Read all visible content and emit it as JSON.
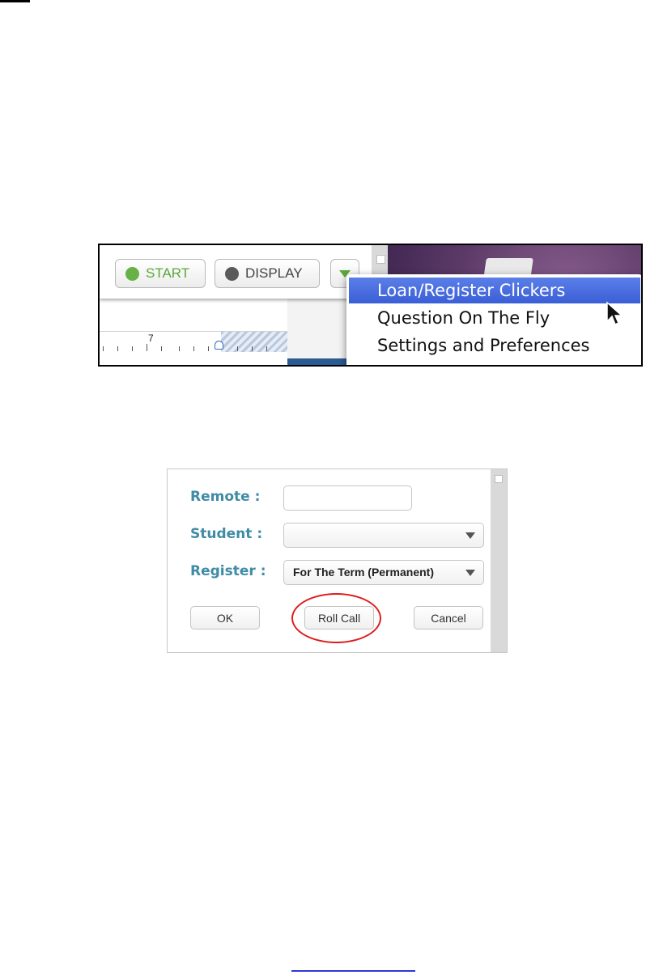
{
  "toolbar": {
    "start_label": "START",
    "display_label": "DISPLAY"
  },
  "ruler": {
    "number": "7"
  },
  "dropdown_menu": {
    "items": [
      {
        "label": "Loan/Register Clickers",
        "highlighted": true
      },
      {
        "label": "Question On The Fly"
      },
      {
        "label": "Settings and Preferences"
      }
    ]
  },
  "register_dialog": {
    "remote_label": "Remote :",
    "remote_value": "",
    "student_label": "Student :",
    "student_value": "",
    "register_label": "Register :",
    "register_value": "For The Term (Permanent)",
    "ok_label": "OK",
    "roll_call_label": "Roll Call",
    "cancel_label": "Cancel"
  },
  "colors": {
    "start_green": "#67b146",
    "menu_highlight": "#3a5fd6",
    "label_teal": "#3f8ba5",
    "annotation_red": "#e01b1b"
  }
}
